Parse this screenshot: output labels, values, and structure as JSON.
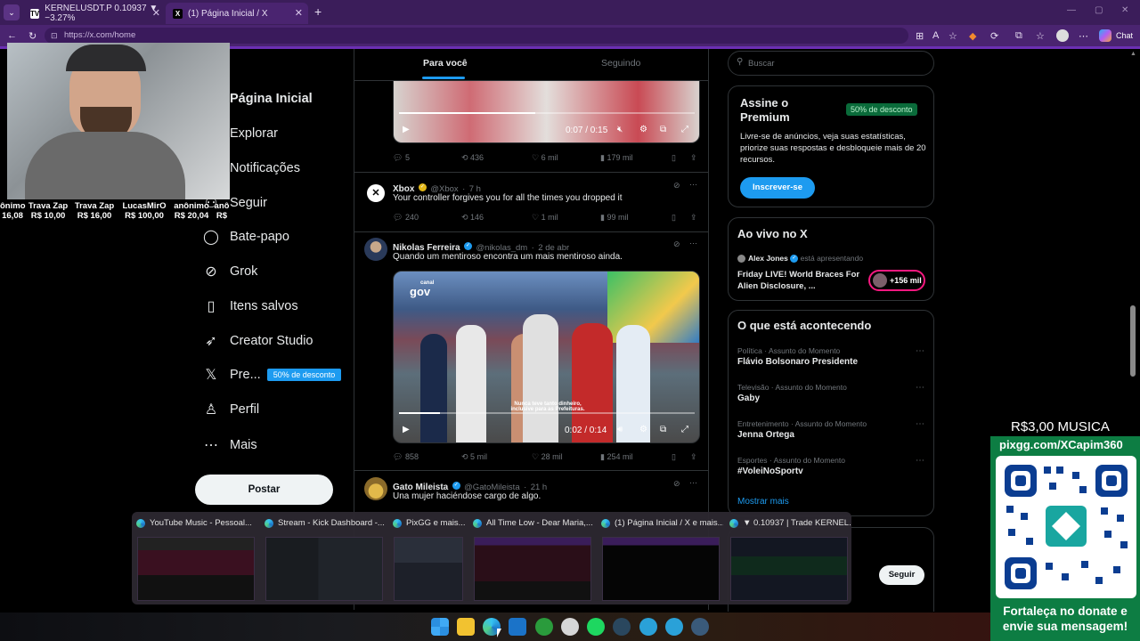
{
  "browser": {
    "tabs": [
      {
        "label": "KERNELUSDT.P 0.10937 ▼ −3.27%",
        "icon_text": "TV"
      },
      {
        "label": "(1) Página Inicial / X",
        "icon_text": "X"
      }
    ],
    "url": "https://x.com/home",
    "chat_label": "Chat"
  },
  "sidebar": {
    "items": [
      {
        "label": "Página Inicial",
        "icon": "home-icon",
        "glyph": "⌂"
      },
      {
        "label": "Explorar",
        "icon": "search-icon",
        "glyph": "⚲"
      },
      {
        "label": "Notificações",
        "icon": "bell-icon",
        "glyph": "🔔"
      },
      {
        "label": "Seguir",
        "icon": "follow-icon",
        "glyph": "⚇"
      },
      {
        "label": "Bate-papo",
        "icon": "chat-icon",
        "glyph": "◯"
      },
      {
        "label": "Grok",
        "icon": "grok-icon",
        "glyph": "⊘"
      },
      {
        "label": "Itens salvos",
        "icon": "bookmark-icon",
        "glyph": "▯"
      },
      {
        "label": "Creator Studio",
        "icon": "rocket-icon",
        "glyph": "➶"
      },
      {
        "label": "Pre...",
        "icon": "x-logo-icon",
        "glyph": "𝕏"
      },
      {
        "label": "Perfil",
        "icon": "person-icon",
        "glyph": "♙"
      },
      {
        "label": "Mais",
        "icon": "more-icon",
        "glyph": "⋯"
      }
    ],
    "premium_badge": "50% de desconto",
    "post_button": "Postar"
  },
  "timeline": {
    "tabs": [
      "Para você",
      "Seguindo"
    ],
    "video1": {
      "time": "0:07 / 0:15",
      "progress": 0.46
    },
    "tweet1_stats": {
      "replies": "5",
      "reposts": "436",
      "likes": "6 mil",
      "views": "179 mil"
    },
    "tweet2": {
      "name": "Xbox",
      "handle": "@Xbox",
      "time": "7 h",
      "text": "Your controller forgives you for all the times you dropped it",
      "stats": {
        "replies": "240",
        "reposts": "146",
        "likes": "1 mil",
        "views": "99 mil"
      }
    },
    "tweet3": {
      "name": "Nikolas Ferreira",
      "handle": "@nikolas_dm",
      "time": "2 de abr",
      "text": "Quando um mentiroso encontra um mais mentiroso ainda.",
      "video_logo": "gov",
      "video_logo_small": "canal",
      "video_caption": "Nunca teve tanto dinheiro, inclusive para as Prefeituras.",
      "video_time": "0:02 / 0:14",
      "video_progress": 0.14,
      "stats": {
        "replies": "858",
        "reposts": "5 mil",
        "likes": "28 mil",
        "views": "254 mil"
      }
    },
    "tweet4": {
      "name": "Gato Mileista",
      "handle": "@GatoMileista",
      "time": "21 h",
      "text": "Una mujer haciéndose cargo de algo."
    }
  },
  "right": {
    "search_placeholder": "Buscar",
    "premium": {
      "title": "Assine o Premium",
      "badge": "50% de desconto",
      "text": "Livre-se de anúncios, veja suas estatísticas, priorize suas respostas e desbloqueie mais de 20 recursos.",
      "button": "Inscrever-se"
    },
    "live": {
      "title": "Ao vivo no X",
      "host": "Alex Jones",
      "host_suffix": "está apresentando",
      "show": "Friday LIVE! World Braces For Alien Disclosure, ...",
      "count": "+156 mil"
    },
    "trends": {
      "title": "O que está acontecendo",
      "items": [
        {
          "cat": "Política · Assunto do Momento",
          "name": "Flávio Bolsonaro Presidente"
        },
        {
          "cat": "Televisão · Assunto do Momento",
          "name": "Gaby"
        },
        {
          "cat": "Entretenimento · Assunto do Momento",
          "name": "Jenna Ortega"
        },
        {
          "cat": "Esportes · Assunto do Momento",
          "name": "#VoleiNoSportv"
        }
      ],
      "more": "Mostrar mais"
    },
    "follow_button": "Seguir"
  },
  "taskbar_previews": [
    "YouTube Music - Pessoal...",
    "Stream - Kick Dashboard -...",
    "PixGG e mais...",
    "All Time Low - Dear Maria,...",
    "(1) Página Inicial / X e mais...",
    "▼ 0.10937 | Trade KERNEL..."
  ],
  "stream_overlay": {
    "donations": [
      {
        "name": "ônimo",
        "amount": "16,08"
      },
      {
        "name": "Trava Zap",
        "amount": "R$ 10,00"
      },
      {
        "name": "Trava Zap",
        "amount": "R$ 16,00"
      },
      {
        "name": "LucasMirO",
        "amount": "R$ 100,00"
      },
      {
        "name": "anônimo",
        "amount": "R$ 20,04"
      },
      {
        "name": "anô",
        "amount": "R$"
      }
    ],
    "price_line": "R$3,00 MUSICA",
    "pix_url": "pixgg.com/XCapim360",
    "cta": "Fortaleça no donate e envie sua mensagem!"
  },
  "colors": {
    "accent": "#1d9bf0",
    "browser": "#3b1d5a",
    "qr_panel": "#0d7d43",
    "premium_green": "#0a6b3a"
  }
}
